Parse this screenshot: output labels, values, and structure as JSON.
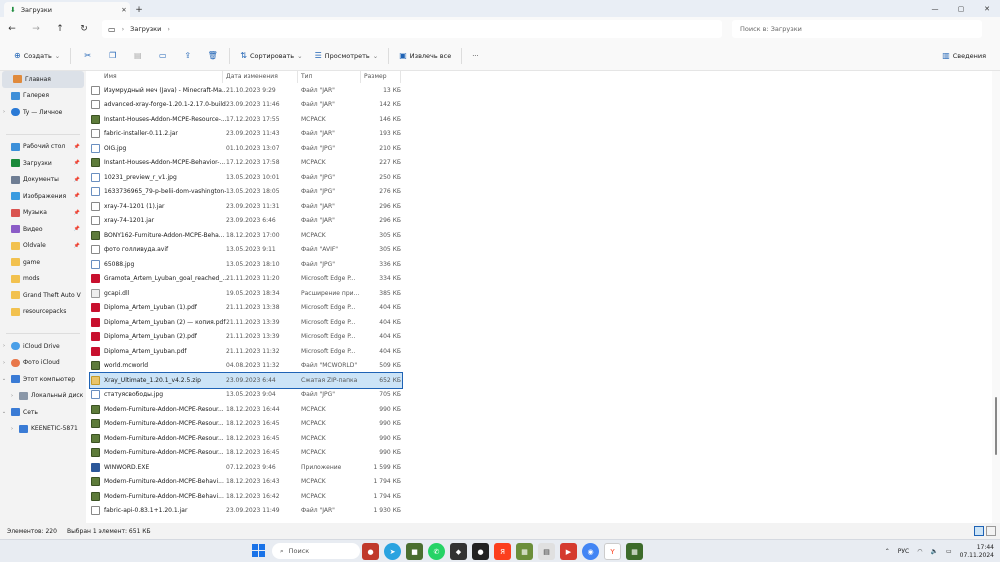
{
  "window": {
    "tab_title": "Загрузки",
    "new_tab": "+",
    "close_tab": "✕",
    "controls": [
      "—",
      "▢",
      "✕"
    ]
  },
  "address": {
    "path": [
      "Загрузки"
    ],
    "search_placeholder": "Поиск в: Загрузки"
  },
  "toolbar": {
    "create": "Создать",
    "sort": "Сортировать",
    "view": "Просмотреть",
    "extract_all": "Извлечь все",
    "more": "···",
    "details": "Сведения"
  },
  "sidebar": {
    "home": "Главная",
    "gallery": "Галерея",
    "personal": "Ty — Личное",
    "desktop": "Рабочий стол",
    "downloads": "Загрузки",
    "documents": "Документы",
    "images": "Изображения",
    "music": "Музыка",
    "video": "Видео",
    "oldvale": "Oldvale",
    "game": "game",
    "mods": "mods",
    "gta": "Grand Theft Auto V",
    "resourcepacks": "resourcepacks",
    "icloud_drive": "iCloud Drive",
    "icloud_photos": "Фото iCloud",
    "this_pc": "Этот компьютер",
    "local_disk": "Локальный диск",
    "network": "Сеть",
    "keenetic": "KEENETIC-5871"
  },
  "columns": {
    "name": "Имя",
    "date": "Дата изменения",
    "type": "Тип",
    "size": "Размер"
  },
  "files": [
    {
      "name": "Изумрудный меч (Java) - Minecraft-Ma...",
      "date": "21.10.2023 9:29",
      "type": "Файл \"JAR\"",
      "size": "13 КБ",
      "icon": "doc"
    },
    {
      "name": "advanced-xray-forge-1.20.1-2.17.0-build...",
      "date": "23.09.2023 11:46",
      "type": "Файл \"JAR\"",
      "size": "142 КБ",
      "icon": "doc"
    },
    {
      "name": "Instant-Houses-Addon-MCPE-Resource-...",
      "date": "17.12.2023 17:55",
      "type": "MCPACK",
      "size": "146 КБ",
      "icon": "mc"
    },
    {
      "name": "fabric-installer-0.11.2.jar",
      "date": "23.09.2023 11:43",
      "type": "Файл \"JAR\"",
      "size": "193 КБ",
      "icon": "doc"
    },
    {
      "name": "OIG.jpg",
      "date": "01.10.2023 13:07",
      "type": "Файл \"JPG\"",
      "size": "210 КБ",
      "icon": "img"
    },
    {
      "name": "Instant-Houses-Addon-MCPE-Behavior-...",
      "date": "17.12.2023 17:58",
      "type": "MCPACK",
      "size": "227 КБ",
      "icon": "mc"
    },
    {
      "name": "10231_preview_r_v1.jpg",
      "date": "13.05.2023 10:01",
      "type": "Файл \"JPG\"",
      "size": "250 КБ",
      "icon": "img"
    },
    {
      "name": "1633736965_79-p-belii-dom-vashington-...",
      "date": "13.05.2023 18:05",
      "type": "Файл \"JPG\"",
      "size": "276 КБ",
      "icon": "img"
    },
    {
      "name": "xray-74-1201 (1).jar",
      "date": "23.09.2023 11:31",
      "type": "Файл \"JAR\"",
      "size": "296 КБ",
      "icon": "doc"
    },
    {
      "name": "xray-74-1201.jar",
      "date": "23.09.2023 6:46",
      "type": "Файл \"JAR\"",
      "size": "296 КБ",
      "icon": "doc"
    },
    {
      "name": "BONY162-Furniture-Addon-MCPE-Beha...",
      "date": "18.12.2023 17:00",
      "type": "MCPACK",
      "size": "305 КБ",
      "icon": "mc"
    },
    {
      "name": "фото голливуда.avif",
      "date": "13.05.2023 9:11",
      "type": "Файл \"AVIF\"",
      "size": "305 КБ",
      "icon": "doc"
    },
    {
      "name": "65088.jpg",
      "date": "13.05.2023 18:10",
      "type": "Файл \"JPG\"",
      "size": "336 КБ",
      "icon": "img"
    },
    {
      "name": "Gramota_Artem_Lyuban_goal_reached_...",
      "date": "21.11.2023 11:20",
      "type": "Microsoft Edge P...",
      "size": "334 КБ",
      "icon": "pdf"
    },
    {
      "name": "gcapi.dll",
      "date": "19.05.2023 18:34",
      "type": "Расширение при...",
      "size": "385 КБ",
      "icon": "dll"
    },
    {
      "name": "Diploma_Artem_Lyuban (1).pdf",
      "date": "21.11.2023 13:38",
      "type": "Microsoft Edge P...",
      "size": "404 КБ",
      "icon": "pdf"
    },
    {
      "name": "Diploma_Artem_Lyuban (2) — копия.pdf",
      "date": "21.11.2023 13:39",
      "type": "Microsoft Edge P...",
      "size": "404 КБ",
      "icon": "pdf"
    },
    {
      "name": "Diploma_Artem_Lyuban (2).pdf",
      "date": "21.11.2023 13:39",
      "type": "Microsoft Edge P...",
      "size": "404 КБ",
      "icon": "pdf"
    },
    {
      "name": "Diploma_Artem_Lyuban.pdf",
      "date": "21.11.2023 11:32",
      "type": "Microsoft Edge P...",
      "size": "404 КБ",
      "icon": "pdf"
    },
    {
      "name": "world.mcworld",
      "date": "04.08.2023 11:32",
      "type": "Файл \"MCWORLD\"",
      "size": "509 КБ",
      "icon": "mc"
    },
    {
      "name": "Xray_Ultimate_1.20.1_v4.2.5.zip",
      "date": "23.09.2023 6:44",
      "type": "Сжатая ZIP-папка",
      "size": "652 КБ",
      "icon": "zip",
      "selected": true
    },
    {
      "name": "статуясвободы.jpg",
      "date": "13.05.2023 9:04",
      "type": "Файл \"JPG\"",
      "size": "705 КБ",
      "icon": "img"
    },
    {
      "name": "Modern-Furniture-Addon-MCPE-Resour...",
      "date": "18.12.2023 16:44",
      "type": "MCPACK",
      "size": "990 КБ",
      "icon": "mc"
    },
    {
      "name": "Modern-Furniture-Addon-MCPE-Resour...",
      "date": "18.12.2023 16:45",
      "type": "MCPACK",
      "size": "990 КБ",
      "icon": "mc"
    },
    {
      "name": "Modern-Furniture-Addon-MCPE-Resour...",
      "date": "18.12.2023 16:45",
      "type": "MCPACK",
      "size": "990 КБ",
      "icon": "mc"
    },
    {
      "name": "Modern-Furniture-Addon-MCPE-Resour...",
      "date": "18.12.2023 16:45",
      "type": "MCPACK",
      "size": "990 КБ",
      "icon": "mc"
    },
    {
      "name": "WINWORD.EXE",
      "date": "07.12.2023 9:46",
      "type": "Приложение",
      "size": "1 599 КБ",
      "icon": "exe"
    },
    {
      "name": "Modern-Furniture-Addon-MCPE-Behavi...",
      "date": "18.12.2023 16:43",
      "type": "MCPACK",
      "size": "1 794 КБ",
      "icon": "mc"
    },
    {
      "name": "Modern-Furniture-Addon-MCPE-Behavi...",
      "date": "18.12.2023 16:42",
      "type": "MCPACK",
      "size": "1 794 КБ",
      "icon": "mc"
    },
    {
      "name": "fabric-api-0.83.1+1.20.1.jar",
      "date": "23.09.2023 11:49",
      "type": "Файл \"JAR\"",
      "size": "1 930 КБ",
      "icon": "doc"
    }
  ],
  "status": {
    "count": "Элементов: 220",
    "selected": "Выбран 1 элемент: 651 КБ"
  },
  "taskbar": {
    "search": "Поиск",
    "lang": "РУС",
    "time": "17:44",
    "date": "07.11.2024"
  }
}
